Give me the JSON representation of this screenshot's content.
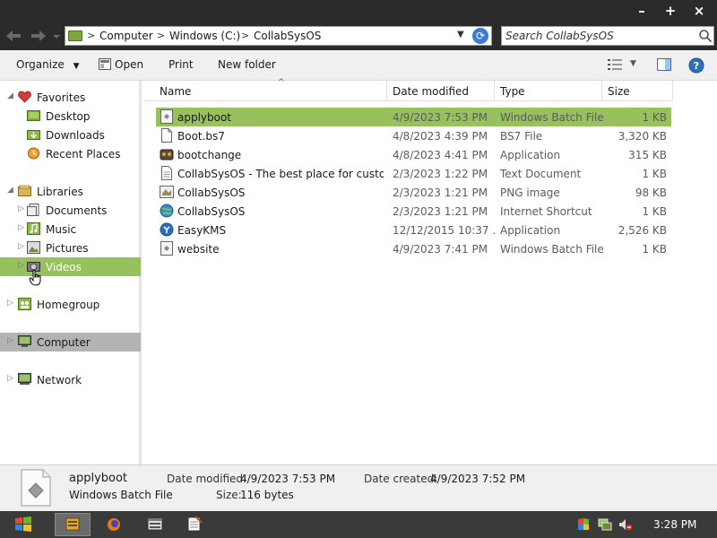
{
  "window": {
    "minimize_label": "–",
    "maximize_label": "+",
    "close_label": "×"
  },
  "address": {
    "breadcrumbs": [
      "Computer",
      "Windows (C:)",
      "CollabSysOS"
    ],
    "separator": ">"
  },
  "search": {
    "placeholder": "Search CollabSysOS"
  },
  "toolbar": {
    "organize": "Organize",
    "open": "Open",
    "print": "Print",
    "new_folder": "New folder"
  },
  "sidebar": {
    "favorites": "Favorites",
    "desktop": "Desktop",
    "downloads": "Downloads",
    "recent_places": "Recent Places",
    "libraries": "Libraries",
    "documents": "Documents",
    "music": "Music",
    "pictures": "Pictures",
    "videos": "Videos",
    "homegroup": "Homegroup",
    "computer": "Computer",
    "network": "Network"
  },
  "columns": {
    "name": "Name",
    "date_modified": "Date modified",
    "type": "Type",
    "size": "Size"
  },
  "files": [
    {
      "name": "applyboot",
      "date": "4/9/2023 7:53 PM",
      "type": "Windows Batch File",
      "size": "1 KB",
      "icon": "batch-file-icon",
      "selected": true
    },
    {
      "name": "Boot.bs7",
      "date": "4/8/2023 4:39 PM",
      "type": "BS7 File",
      "size": "3,320 KB",
      "icon": "generic-file-icon"
    },
    {
      "name": "bootchange",
      "date": "4/8/2023 4:41 PM",
      "type": "Application",
      "size": "315 KB",
      "icon": "application-icon"
    },
    {
      "name": "CollabSysOS - The best place for custom ...",
      "date": "2/3/2023 1:22 PM",
      "type": "Text Document",
      "size": "1 KB",
      "icon": "text-file-icon"
    },
    {
      "name": "CollabSysOS",
      "date": "2/3/2023 1:21 PM",
      "type": "PNG image",
      "size": "98 KB",
      "icon": "image-file-icon"
    },
    {
      "name": "CollabSysOS",
      "date": "2/3/2023 1:21 PM",
      "type": "Internet Shortcut",
      "size": "1 KB",
      "icon": "internet-shortcut-icon"
    },
    {
      "name": "EasyKMS",
      "date": "12/12/2015 10:37 ...",
      "type": "Application",
      "size": "2,526 KB",
      "icon": "easykms-app-icon"
    },
    {
      "name": "website",
      "date": "4/9/2023 7:41 PM",
      "type": "Windows Batch File",
      "size": "1 KB",
      "icon": "batch-file-icon"
    }
  ],
  "details": {
    "file_name": "applyboot",
    "file_type": "Windows Batch File",
    "date_modified_label": "Date modified:",
    "date_modified_value": "4/9/2023 7:53 PM",
    "size_label": "Size:",
    "size_value": "116 bytes",
    "date_created_label": "Date created:",
    "date_created_value": "4/9/2023 7:52 PM"
  },
  "taskbar": {
    "clock": "3:28 PM"
  },
  "colors": {
    "accent_green": "#97c15c",
    "chrome_dark": "#2b2b2b",
    "panel_gray": "#f0f0f0"
  }
}
